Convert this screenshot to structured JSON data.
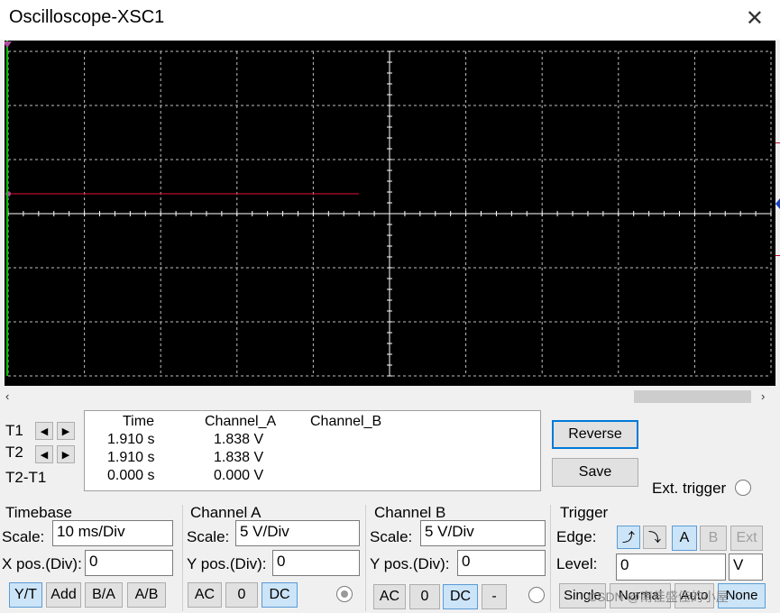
{
  "window": {
    "title": "Oscilloscope-XSC1",
    "close_glyph": "✕"
  },
  "scroll": {
    "left_arrow": "‹",
    "right_arrow": "›"
  },
  "chart_data": {
    "type": "line",
    "grid": true,
    "x_divisions": 10,
    "y_divisions": 6,
    "x_unit": "ms",
    "y_unit": "V",
    "xlim": [
      0,
      100
    ],
    "ylim": [
      -15,
      15
    ],
    "series": [
      {
        "channel": "A",
        "color": "#c8102e",
        "x": [
          0,
          46
        ],
        "y": [
          1.838,
          1.838
        ]
      }
    ],
    "colors": {
      "background": "#000000",
      "grid": "#bfbfbf",
      "axis": "#ffffff",
      "cursor": "#00c000"
    }
  },
  "cursors": {
    "t1_label": "T1",
    "t2_label": "T2",
    "diff_label": "T2-T1",
    "left_glyph": "◀",
    "right_glyph": "▶"
  },
  "readout": {
    "headers": [
      "Time",
      "Channel_A",
      "Channel_B"
    ],
    "rows": [
      [
        "1.910 s",
        "1.838 V",
        ""
      ],
      [
        "1.910 s",
        "1.838 V",
        ""
      ],
      [
        "0.000 s",
        "0.000 V",
        ""
      ]
    ]
  },
  "actions": {
    "reverse": "Reverse",
    "save": "Save",
    "ext_trigger": "Ext. trigger"
  },
  "timebase": {
    "title": "Timebase",
    "scale_label": "Scale:",
    "scale_value": "10 ms/Div",
    "xpos_label": "X pos.(Div):",
    "xpos_value": "0",
    "modes": [
      "Y/T",
      "Add",
      "B/A",
      "A/B"
    ],
    "selected_mode": "Y/T"
  },
  "channel_a": {
    "title": "Channel A",
    "scale_label": "Scale:",
    "scale_value": "5  V/Div",
    "ypos_label": "Y pos.(Div):",
    "ypos_value": "0",
    "couplings": [
      "AC",
      "0",
      "DC"
    ],
    "selected_coupling": "DC"
  },
  "channel_b": {
    "title": "Channel B",
    "scale_label": "Scale:",
    "scale_value": "5  V/Div",
    "ypos_label": "Y pos.(Div):",
    "ypos_value": "0",
    "couplings": [
      "AC",
      "0",
      "DC",
      "-"
    ],
    "selected_coupling": "DC"
  },
  "trigger": {
    "title": "Trigger",
    "edge_label": "Edge:",
    "edge_rise": "⤴",
    "edge_fall": "⤵",
    "sources": [
      "A",
      "B",
      "Ext"
    ],
    "selected_source": "A",
    "level_label": "Level:",
    "level_value": "0",
    "level_unit": "V",
    "modes": [
      "Single",
      "Normal",
      "Auto",
      "None"
    ],
    "selected_mode": "None"
  },
  "watermark": "CSDN @南佳盛佳的小屋"
}
